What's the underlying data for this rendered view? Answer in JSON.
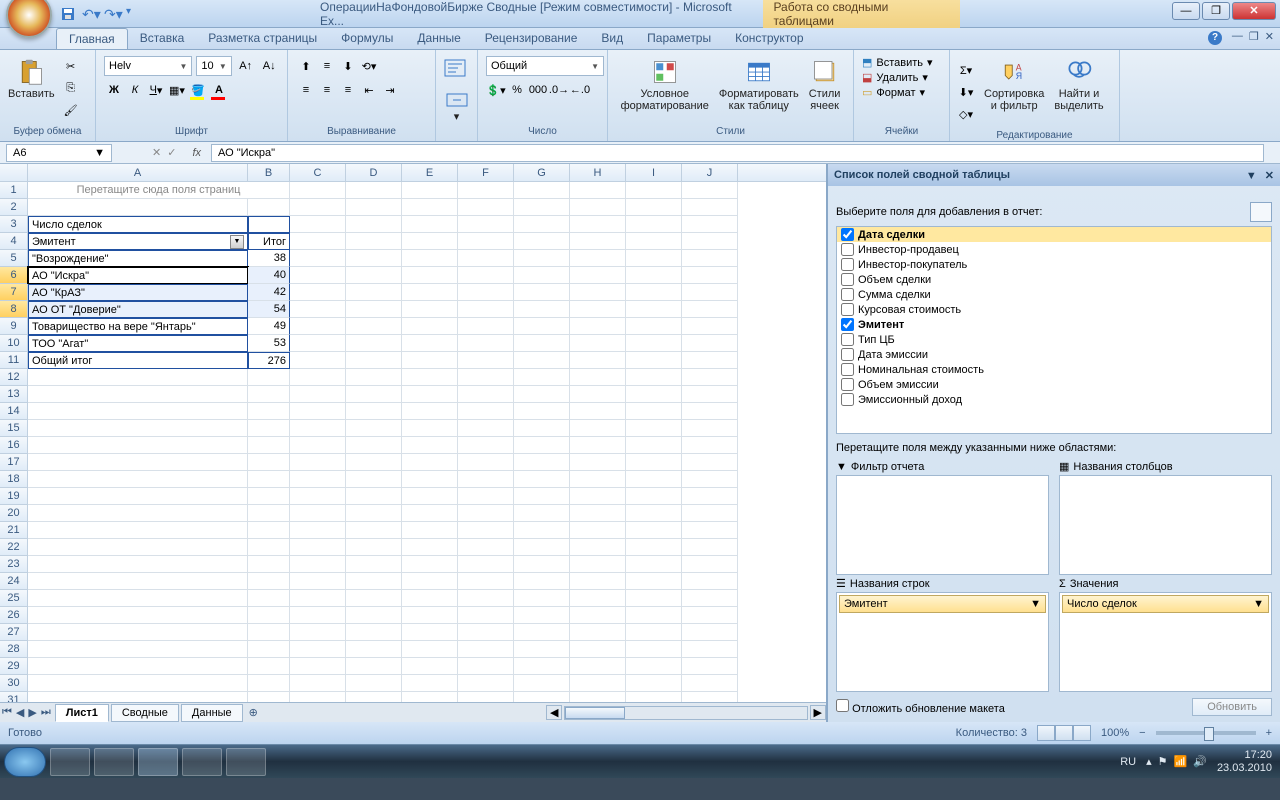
{
  "title": "ОперацииНаФондовойБирже  Сводные  [Режим совместимости] - Microsoft Ex...",
  "context_tab": "Работа со сводными таблицами",
  "tabs": [
    "Главная",
    "Вставка",
    "Разметка страницы",
    "Формулы",
    "Данные",
    "Рецензирование",
    "Вид",
    "Параметры",
    "Конструктор"
  ],
  "active_tab": 0,
  "ribbon_groups": {
    "clipboard": "Буфер обмена",
    "paste": "Вставить",
    "font": "Шрифт",
    "alignment": "Выравнивание",
    "number": "Число",
    "number_fmt": "Общий",
    "styles": "Стили",
    "cond_fmt": "Условное\nформатирование",
    "fmt_table": "Форматировать\nкак таблицу",
    "cell_styles": "Стили\nячеек",
    "cells": "Ячейки",
    "insert": "Вставить",
    "delete": "Удалить",
    "format": "Формат",
    "editing": "Редактирование",
    "sort": "Сортировка\nи фильтр",
    "find": "Найти и\nвыделить"
  },
  "font_name": "Helv",
  "font_size": "10",
  "namebox": "A6",
  "formula": "АО \"Искра\"",
  "columns": [
    "A",
    "B",
    "C",
    "D",
    "E",
    "F",
    "G",
    "H",
    "I",
    "J"
  ],
  "hint_row1": "Перетащите сюда поля страниц",
  "pt": {
    "measure": "Число сделок",
    "field": "Эмитент",
    "total_hdr": "Итог",
    "rows": [
      {
        "label": "\"Возрождение\"",
        "val": 38
      },
      {
        "label": "АО \"Искра\"",
        "val": 40
      },
      {
        "label": "АО \"КрАЗ\"",
        "val": 42
      },
      {
        "label": "АО ОТ \"Доверие\"",
        "val": 54
      },
      {
        "label": "Товарищество на вере \"Янтарь\"",
        "val": 49
      },
      {
        "label": "ТОО \"Агат\"",
        "val": 53
      }
    ],
    "grand_label": "Общий итог",
    "grand_val": 276
  },
  "sheets": [
    "Лист1",
    "Сводные",
    "Данные"
  ],
  "active_sheet": 0,
  "status_ready": "Готово",
  "status_count_label": "Количество: 3",
  "zoom": "100%",
  "pane": {
    "title": "Список полей сводной таблицы",
    "hint": "Выберите поля для добавления в отчет:",
    "fields": [
      {
        "name": "Дата сделки",
        "checked": true,
        "hl": true
      },
      {
        "name": "Инвестор-продавец",
        "checked": false
      },
      {
        "name": "Инвестор-покупатель",
        "checked": false
      },
      {
        "name": "Объем сделки",
        "checked": false
      },
      {
        "name": "Сумма сделки",
        "checked": false
      },
      {
        "name": "Курсовая стоимость",
        "checked": false
      },
      {
        "name": "Эмитент",
        "checked": true
      },
      {
        "name": "Тип ЦБ",
        "checked": false
      },
      {
        "name": "Дата эмиссии",
        "checked": false
      },
      {
        "name": "Номинальная стоимость",
        "checked": false
      },
      {
        "name": "Объем эмиссии",
        "checked": false
      },
      {
        "name": "Эмиссионный доход",
        "checked": false
      }
    ],
    "areas_hint": "Перетащите поля между указанными ниже областями:",
    "area_filter": "Фильтр отчета",
    "area_cols": "Названия столбцов",
    "area_rows": "Названия строк",
    "area_vals": "Значения",
    "row_item": "Эмитент",
    "val_item": "Число сделок",
    "defer": "Отложить обновление макета",
    "update": "Обновить"
  },
  "tray": {
    "lang": "RU",
    "time": "17:20",
    "date": "23.03.2010"
  }
}
